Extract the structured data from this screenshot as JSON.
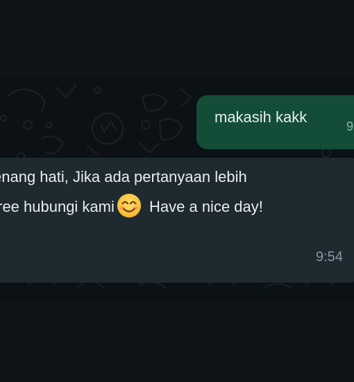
{
  "messages": {
    "outgoing": {
      "text": "makasih kakk",
      "time_partial": "9"
    },
    "incoming": {
      "line1": "enang hati, Jika ada pertanyaan lebih",
      "line2_before": " free hubungi kami",
      "emoji": "smiling-face-emoji",
      "line2_after": " Have a nice day!",
      "time": "9:54"
    }
  },
  "colors": {
    "background": "#101318",
    "chat_background": "#0c1115",
    "outgoing_bubble": "#134d37",
    "incoming_bubble": "#1f2a30",
    "text": "#e9edef",
    "timestamp": "#8696a0"
  }
}
